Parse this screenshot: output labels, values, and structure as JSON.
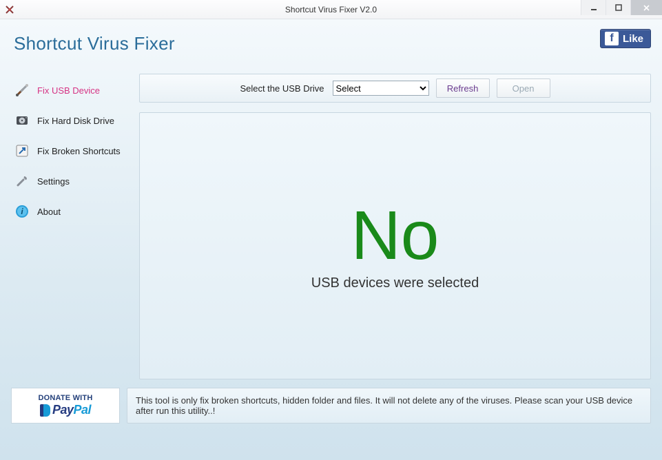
{
  "window": {
    "title": "Shortcut Virus Fixer V2.0"
  },
  "header": {
    "app_title": "Shortcut Virus Fixer",
    "fb_like_label": "Like"
  },
  "sidebar": {
    "items": [
      {
        "label": "Fix USB Device",
        "icon": "tools-icon",
        "active": true
      },
      {
        "label": "Fix Hard Disk Drive",
        "icon": "hdd-icon",
        "active": false
      },
      {
        "label": "Fix Broken Shortcuts",
        "icon": "shortcut-icon",
        "active": false
      },
      {
        "label": "Settings",
        "icon": "wrench-icon",
        "active": false
      },
      {
        "label": "About",
        "icon": "info-icon",
        "active": false
      }
    ]
  },
  "controls": {
    "select_label": "Select the USB Drive",
    "select_value": "Select",
    "refresh_label": "Refresh",
    "open_label": "Open"
  },
  "status": {
    "big_text": "No",
    "sub_text": "USB devices were selected"
  },
  "footer": {
    "donate_top": "Donate with",
    "paypal_pay": "Pay",
    "paypal_pal": "Pal",
    "info_text": "This tool is only fix broken shortcuts, hidden folder and files. It will not delete any of the viruses. Please scan your USB device after run this utility..!"
  }
}
